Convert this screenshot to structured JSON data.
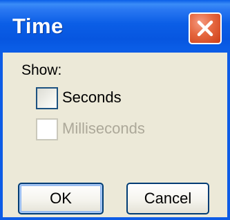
{
  "window": {
    "title": "Time"
  },
  "icons": {
    "close": "close-icon"
  },
  "colors": {
    "titlebar": "#0d5ce6",
    "close_button": "#e5673f",
    "dialog_background": "#ece9d8",
    "disabled_text": "#aca899"
  },
  "body": {
    "show_label": "Show:",
    "options": [
      {
        "label": "Seconds",
        "checked": false,
        "enabled": true
      },
      {
        "label": "Milliseconds",
        "checked": false,
        "enabled": false
      }
    ]
  },
  "buttons": {
    "ok_label": "OK",
    "cancel_label": "Cancel"
  }
}
